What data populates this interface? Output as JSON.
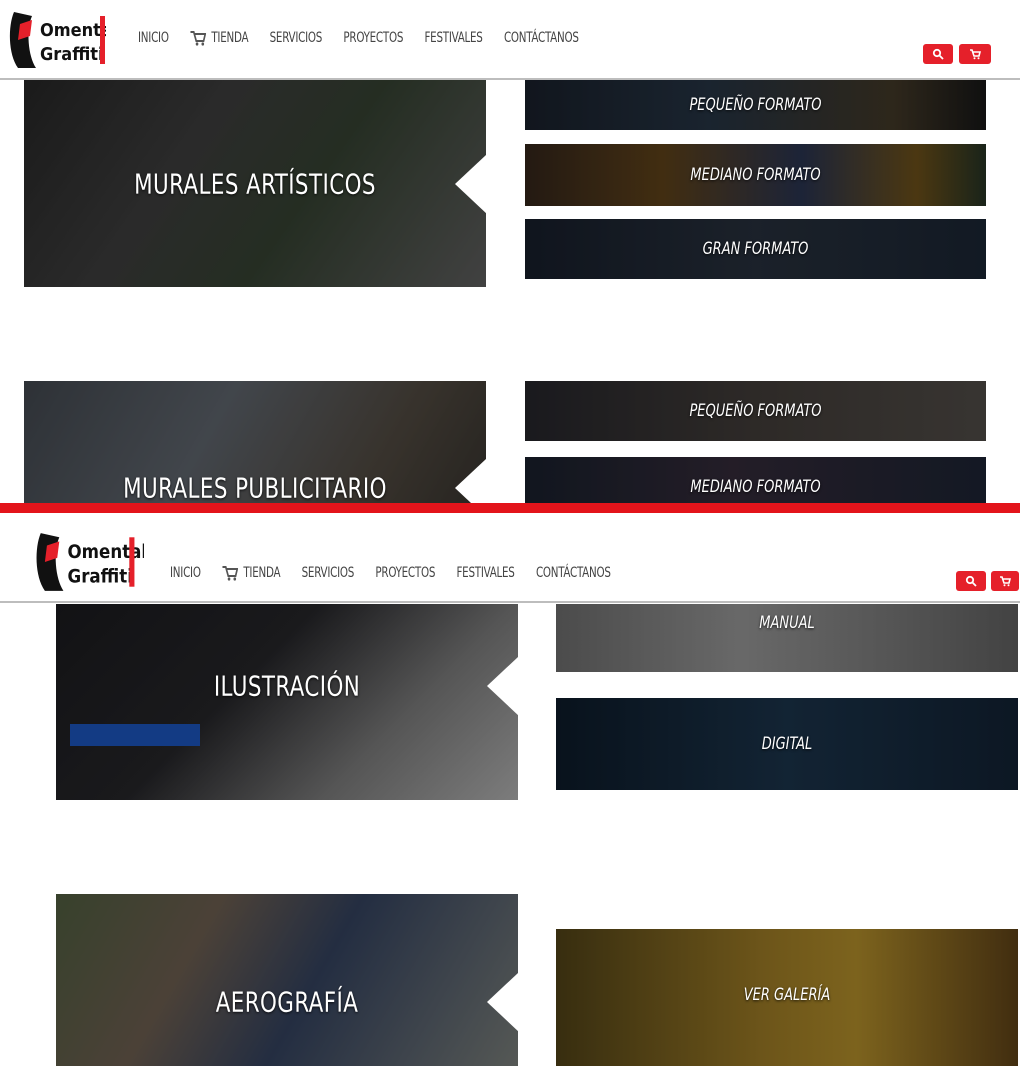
{
  "brand": {
    "line1": "Omental",
    "line2": "Graffiti"
  },
  "nav": {
    "items": [
      "INICIO",
      "TIENDA",
      "SERVICIOS",
      "PROYECTOS",
      "FESTIVALES",
      "CONTÁCTANOS"
    ]
  },
  "icons": {
    "search": "search-icon",
    "cart": "cart-icon",
    "logo": "spray-logo-icon"
  },
  "colors": {
    "accent": "#e5202a",
    "divider": "#e3141b",
    "nav_text": "#444444"
  },
  "shot1": {
    "murales_artisticos": {
      "title": "MURALES ARTÍSTICOS",
      "options": [
        "PEQUEÑO FORMATO",
        "MEDIANO FORMATO",
        "GRAN FORMATO"
      ]
    },
    "murales_publicitario": {
      "title": "MURALES PUBLICITARIO",
      "options": [
        "PEQUEÑO FORMATO",
        "MEDIANO FORMATO"
      ]
    }
  },
  "shot2": {
    "ilustracion": {
      "title": "ILUSTRACIÓN",
      "options": [
        "MANUAL",
        "DIGITAL"
      ]
    },
    "aerografia": {
      "title": "AEROGRAFÍA",
      "options": [
        "VER GALERÍA"
      ]
    }
  }
}
